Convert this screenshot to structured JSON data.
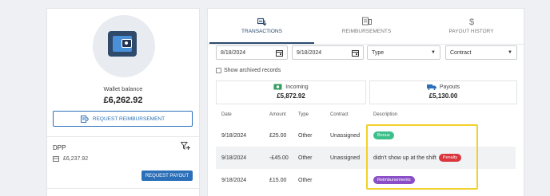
{
  "wallet": {
    "label": "Wallet balance",
    "value": "£6,262.92",
    "icon": "wallet-icon"
  },
  "request_reimbursement": {
    "label": "REQUEST REIMBURSEMENT",
    "icon": "receipt-icon"
  },
  "dpp": {
    "title": "DPP",
    "amount": "£6,237.92",
    "request_payout": "REQUEST PAYOUT"
  },
  "tabs": [
    {
      "label": "TRANSACTIONS",
      "icon": "transactions-icon",
      "active": true
    },
    {
      "label": "REIMBURSEMENTS",
      "icon": "reimbursements-icon",
      "active": false
    },
    {
      "label": "PAYOUT HISTORY",
      "icon": "dollar-icon",
      "active": false
    }
  ],
  "filters": {
    "date_from": "8/18/2024",
    "date_to": "9/18/2024",
    "type": "Type",
    "contract": "Contract",
    "archived_label": "Show archived records"
  },
  "stats": {
    "incoming_label": "Incoming",
    "incoming_value": "£5,872.92",
    "payouts_label": "Payouts",
    "payouts_value": "£5,130.00"
  },
  "table": {
    "headers": [
      "Date",
      "Amount",
      "Type",
      "Contract",
      "Description"
    ],
    "rows": [
      {
        "date": "9/18/2024",
        "amount": "£25.00",
        "type": "Other",
        "contract": "Unassigned",
        "description": "",
        "badge": "Bonus"
      },
      {
        "date": "9/18/2024",
        "amount": "-£45.00",
        "type": "Other",
        "contract": "Unassigned",
        "description": "didn't show up at the shift",
        "badge": "Penalty"
      },
      {
        "date": "9/18/2024",
        "amount": "£15.00",
        "type": "Other",
        "contract": "",
        "description": "",
        "badge": "Reimbursements"
      }
    ]
  },
  "colors": {
    "primary": "#2a6fb8",
    "navy": "#2c4a6e",
    "bonus": "#3dbf8a",
    "penalty": "#d9363e",
    "reimbursements": "#8a4fc6",
    "highlight": "#f2d02b"
  }
}
